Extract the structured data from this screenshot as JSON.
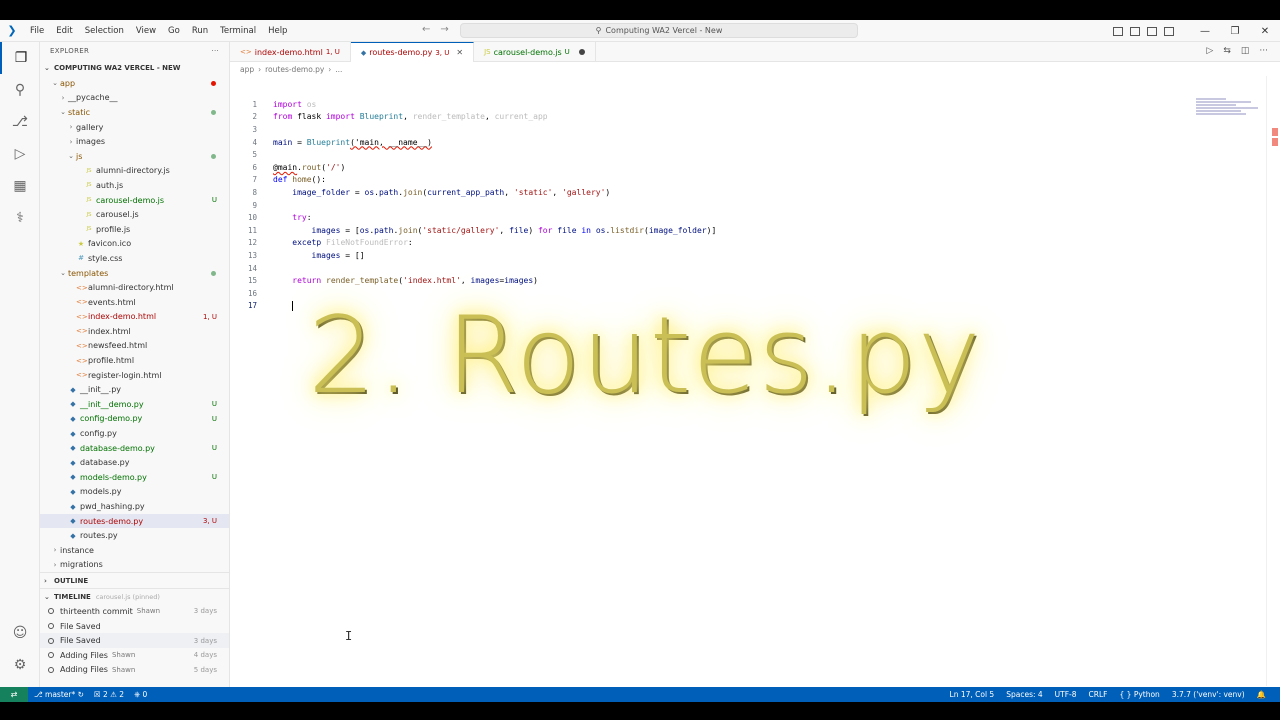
{
  "titlebar": {
    "menu": [
      "File",
      "Edit",
      "Selection",
      "View",
      "Go",
      "Run",
      "Terminal",
      "Help"
    ],
    "title": "Computing WA2 Vercel - New",
    "icon": "vscode-logo-icon"
  },
  "sidebar": {
    "explorer_label": "EXPLORER",
    "root_label": "COMPUTING WA2 VERCEL - NEW",
    "outline_label": "OUTLINE",
    "timeline_label": "TIMELINE",
    "timeline_file": "carousel.js (pinned)",
    "tree": [
      {
        "label": "app",
        "depth": 0,
        "kind": "folder-open",
        "color": "mod",
        "dot": "red"
      },
      {
        "label": "__pycache__",
        "depth": 1,
        "kind": "folder",
        "color": "plain"
      },
      {
        "label": "static",
        "depth": 1,
        "kind": "folder-open",
        "color": "mod",
        "dot": "green"
      },
      {
        "label": "gallery",
        "depth": 2,
        "kind": "folder",
        "color": "plain"
      },
      {
        "label": "images",
        "depth": 2,
        "kind": "folder",
        "color": "plain"
      },
      {
        "label": "js",
        "depth": 2,
        "kind": "folder-open",
        "color": "mod",
        "dot": "green"
      },
      {
        "label": "alumni-directory.js",
        "depth": 3,
        "kind": "js",
        "color": "plain"
      },
      {
        "label": "auth.js",
        "depth": 3,
        "kind": "js",
        "color": "plain"
      },
      {
        "label": "carousel-demo.js",
        "depth": 3,
        "kind": "js",
        "color": "untr",
        "status": "U"
      },
      {
        "label": "carousel.js",
        "depth": 3,
        "kind": "js",
        "color": "plain"
      },
      {
        "label": "profile.js",
        "depth": 3,
        "kind": "js",
        "color": "plain"
      },
      {
        "label": "favicon.ico",
        "depth": 2,
        "kind": "ico",
        "color": "plain"
      },
      {
        "label": "style.css",
        "depth": 2,
        "kind": "css",
        "color": "plain"
      },
      {
        "label": "templates",
        "depth": 1,
        "kind": "folder-open",
        "color": "mod",
        "dot": "green"
      },
      {
        "label": "alumni-directory.html",
        "depth": 2,
        "kind": "html",
        "color": "plain"
      },
      {
        "label": "events.html",
        "depth": 2,
        "kind": "html",
        "color": "plain"
      },
      {
        "label": "index-demo.html",
        "depth": 2,
        "kind": "html",
        "color": "err",
        "status": "1, U"
      },
      {
        "label": "index.html",
        "depth": 2,
        "kind": "html",
        "color": "plain"
      },
      {
        "label": "newsfeed.html",
        "depth": 2,
        "kind": "html",
        "color": "plain"
      },
      {
        "label": "profile.html",
        "depth": 2,
        "kind": "html",
        "color": "plain"
      },
      {
        "label": "register-login.html",
        "depth": 2,
        "kind": "html",
        "color": "plain"
      },
      {
        "label": "__init__.py",
        "depth": 1,
        "kind": "py",
        "color": "plain"
      },
      {
        "label": "__init__demo.py",
        "depth": 1,
        "kind": "py",
        "color": "untr",
        "status": "U"
      },
      {
        "label": "config-demo.py",
        "depth": 1,
        "kind": "py",
        "color": "untr",
        "status": "U"
      },
      {
        "label": "config.py",
        "depth": 1,
        "kind": "py",
        "color": "plain"
      },
      {
        "label": "database-demo.py",
        "depth": 1,
        "kind": "py",
        "color": "untr",
        "status": "U"
      },
      {
        "label": "database.py",
        "depth": 1,
        "kind": "py",
        "color": "plain"
      },
      {
        "label": "models-demo.py",
        "depth": 1,
        "kind": "py",
        "color": "untr",
        "status": "U"
      },
      {
        "label": "models.py",
        "depth": 1,
        "kind": "py",
        "color": "plain"
      },
      {
        "label": "pwd_hashing.py",
        "depth": 1,
        "kind": "py",
        "color": "plain"
      },
      {
        "label": "routes-demo.py",
        "depth": 1,
        "kind": "py",
        "color": "err",
        "status": "3, U",
        "selected": true
      },
      {
        "label": "routes.py",
        "depth": 1,
        "kind": "py",
        "color": "plain"
      },
      {
        "label": "instance",
        "depth": 0,
        "kind": "folder",
        "color": "plain"
      },
      {
        "label": "migrations",
        "depth": 0,
        "kind": "folder",
        "color": "plain"
      }
    ],
    "timeline": [
      {
        "label": "thirteenth commit",
        "author": "Shawn",
        "when": "3 days"
      },
      {
        "label": "File Saved",
        "author": "",
        "when": ""
      },
      {
        "label": "File Saved",
        "author": "",
        "when": "3 days",
        "highlight": true
      },
      {
        "label": "Adding Files",
        "author": "Shawn",
        "when": "4 days"
      },
      {
        "label": "Adding Files",
        "author": "Shawn",
        "when": "5 days"
      }
    ]
  },
  "editor": {
    "tabs": [
      {
        "label": "index-demo.html",
        "status": "1, U",
        "icon": "html-icon",
        "active": false,
        "closeable": false
      },
      {
        "label": "routes-demo.py",
        "status": "3, U",
        "icon": "python-icon",
        "active": true,
        "closeable": true
      },
      {
        "label": "carousel-demo.js",
        "status": "U",
        "icon": "js-icon",
        "active": false,
        "dirty": true
      }
    ],
    "breadcrumb": [
      "app",
      "routes-demo.py",
      "..."
    ],
    "cursor_line": 17,
    "lines": [
      [
        [
          "kw",
          "import"
        ],
        [
          "t",
          " "
        ],
        [
          "dim",
          "os"
        ]
      ],
      [
        [
          "kw",
          "from"
        ],
        [
          "t",
          " flask "
        ],
        [
          "kw",
          "import"
        ],
        [
          "t",
          " "
        ],
        [
          "cls",
          "Blueprint"
        ],
        [
          "t",
          ", "
        ],
        [
          "dim",
          "render_template"
        ],
        [
          "t",
          ", "
        ],
        [
          "dim",
          "current_app"
        ]
      ],
      [],
      [
        [
          "var",
          "main"
        ],
        [
          "t",
          " = "
        ],
        [
          "cls",
          "Blueprint"
        ],
        [
          "squig",
          "('main, __name__)"
        ]
      ],
      [],
      [
        [
          "squig",
          "@main"
        ],
        [
          "t",
          "."
        ],
        [
          "fn",
          "rout"
        ],
        [
          "t",
          "("
        ],
        [
          "str",
          "'/'"
        ],
        [
          "t",
          ")"
        ]
      ],
      [
        [
          "kb",
          "def"
        ],
        [
          "t",
          " "
        ],
        [
          "fn",
          "home"
        ],
        [
          "t",
          "():"
        ]
      ],
      [
        [
          "t",
          "    "
        ],
        [
          "var",
          "image_folder"
        ],
        [
          "t",
          " = "
        ],
        [
          "var",
          "os"
        ],
        [
          "t",
          "."
        ],
        [
          "var",
          "path"
        ],
        [
          "t",
          "."
        ],
        [
          "fn",
          "join"
        ],
        [
          "t",
          "("
        ],
        [
          "var",
          "current_app_path"
        ],
        [
          "t",
          ", "
        ],
        [
          "str",
          "'static'"
        ],
        [
          "t",
          ", "
        ],
        [
          "str",
          "'gallery'"
        ],
        [
          "t",
          ")"
        ]
      ],
      [],
      [
        [
          "t",
          "    "
        ],
        [
          "kw",
          "try"
        ],
        [
          "t",
          ":"
        ]
      ],
      [
        [
          "t",
          "        "
        ],
        [
          "var",
          "images"
        ],
        [
          "t",
          " = ["
        ],
        [
          "var",
          "os"
        ],
        [
          "t",
          "."
        ],
        [
          "var",
          "path"
        ],
        [
          "t",
          "."
        ],
        [
          "fn",
          "join"
        ],
        [
          "t",
          "("
        ],
        [
          "str",
          "'static/gallery'"
        ],
        [
          "t",
          ", "
        ],
        [
          "var",
          "file"
        ],
        [
          "t",
          ") "
        ],
        [
          "kw",
          "for"
        ],
        [
          "t",
          " "
        ],
        [
          "var",
          "file"
        ],
        [
          "t",
          " "
        ],
        [
          "kb",
          "in"
        ],
        [
          "t",
          " "
        ],
        [
          "var",
          "os"
        ],
        [
          "t",
          "."
        ],
        [
          "fn",
          "listdir"
        ],
        [
          "t",
          "("
        ],
        [
          "var",
          "image_folder"
        ],
        [
          "t",
          ")]"
        ]
      ],
      [
        [
          "t",
          "    "
        ],
        [
          "var",
          "excetp"
        ],
        [
          "t",
          " "
        ],
        [
          "dim",
          "FileNotFoundError"
        ],
        [
          "t",
          ":"
        ]
      ],
      [
        [
          "t",
          "        "
        ],
        [
          "var",
          "images"
        ],
        [
          "t",
          " = []"
        ]
      ],
      [],
      [
        [
          "t",
          "    "
        ],
        [
          "kw",
          "return"
        ],
        [
          "t",
          " "
        ],
        [
          "fn",
          "render_template"
        ],
        [
          "t",
          "("
        ],
        [
          "str",
          "'index.html'"
        ],
        [
          "t",
          ", "
        ],
        [
          "var",
          "images"
        ],
        [
          "t",
          "="
        ],
        [
          "var",
          "images"
        ],
        [
          "t",
          ")"
        ]
      ],
      [],
      [
        [
          "t",
          "    "
        ],
        [
          "caret",
          ""
        ]
      ]
    ]
  },
  "overlay": {
    "text": "2. Routes.py"
  },
  "statusbar": {
    "branch": "master*",
    "problems_errors": "2",
    "problems_warnings": "2",
    "ports": "0",
    "position": "Ln 17, Col 5",
    "spaces": "Spaces: 4",
    "encoding": "UTF-8",
    "eol": "CRLF",
    "language": "Python",
    "interpreter": "3.7.7 ('venv': venv)"
  }
}
